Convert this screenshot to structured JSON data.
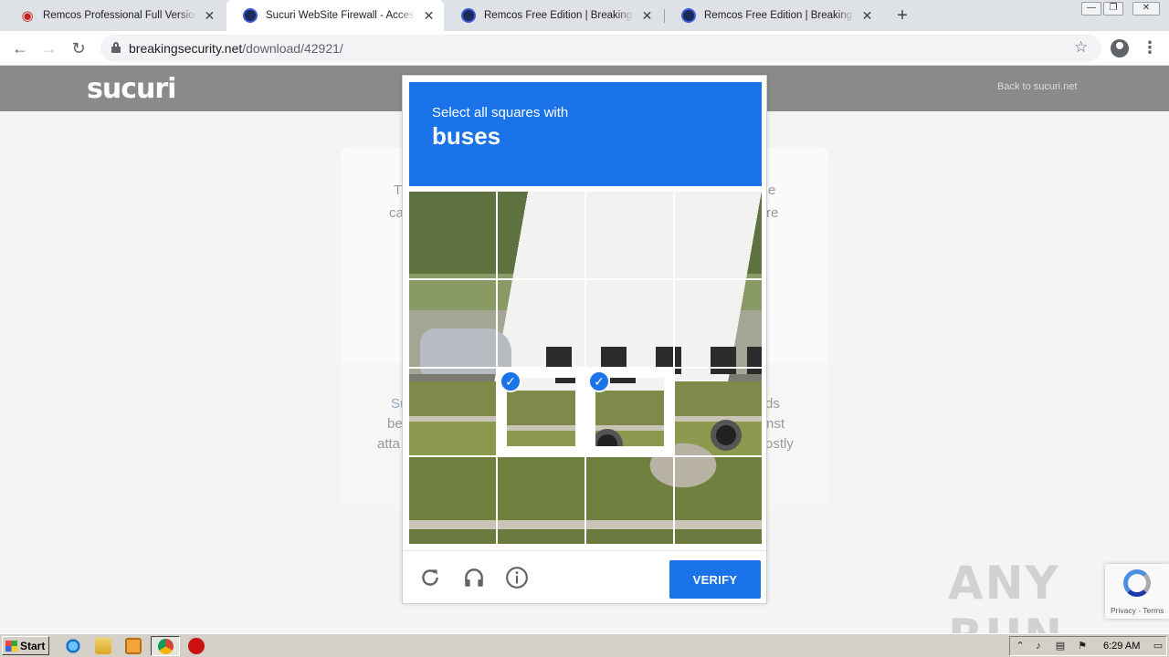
{
  "browser": {
    "tabs": [
      {
        "title": "Remcos Professional Full Version Download",
        "icon": "map-pin-icon",
        "active": false
      },
      {
        "title": "Sucuri WebSite Firewall - Access Denied",
        "icon": "breakingsecurity-icon",
        "active": true
      },
      {
        "title": "Remcos Free Edition | BreakingSecurity",
        "icon": "breakingsecurity-icon",
        "active": false
      },
      {
        "title": "Remcos Free Edition | BreakingSecurity",
        "icon": "breakingsecurity-icon",
        "active": false
      }
    ],
    "new_tab": "+",
    "url_host": "breakingsecurity.net",
    "url_path": "/download/42921/"
  },
  "page": {
    "logo": "sucuri",
    "back_link": "Back to sucuri.net",
    "fragments": {
      "l1a": "T",
      "l1b": "e",
      "l2a": "ca",
      "l2b": "re",
      "l3a": "Su",
      "l3b": "ds",
      "l4a": "be",
      "l4b": "nst",
      "l5a": "atta",
      "l5b": "ostly"
    }
  },
  "captcha": {
    "instruction": "Select all squares with",
    "target": "buses",
    "selected_tiles": [
      9,
      10
    ],
    "verify_label": "VERIFY",
    "footer_icons": [
      "reload-icon",
      "audio-icon",
      "info-icon"
    ]
  },
  "recaptcha_badge": {
    "terms": "Privacy - Terms"
  },
  "watermark": "ANY RUN",
  "taskbar": {
    "start_label": "Start",
    "clock": "6:29 AM"
  },
  "colors": {
    "captcha_blue": "#1a73e8",
    "header_gray": "#8a8a8a",
    "tab_strip": "#dee1e6"
  }
}
